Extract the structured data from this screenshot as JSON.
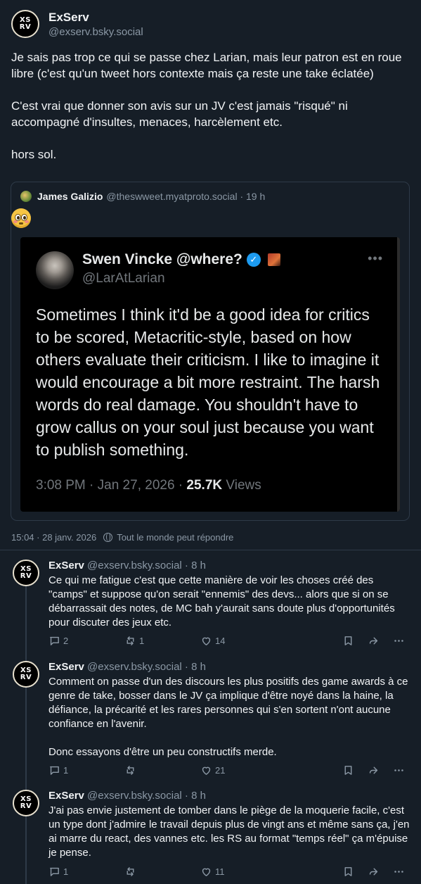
{
  "main_post": {
    "author": {
      "display_name": "ExServ",
      "handle": "@exserv.bsky.social",
      "avatar_text": [
        "XS",
        "RV"
      ]
    },
    "paragraphs": [
      "Je sais pas trop ce qui se passe chez Larian, mais leur patron est en roue libre (c'est qu'un tweet hors contexte mais ça reste une take éclatée)",
      "C'est vrai que donner son avis sur un JV c'est jamais \"risqué\" ni accompagné d'insultes, menaces, harcèlement etc.",
      "hors sol."
    ],
    "quote": {
      "display_name": "James Galizio",
      "handle_time": "@theswweet.myatproto.social · 19 h",
      "emoji": "flushed-face",
      "embedded_tweet": {
        "name": "Swen Vincke @where?",
        "handle": "@LarAtLarian",
        "body": "Sometimes I think it'd be a good idea for critics to be scored, Metacritic-style, based on how others evaluate their criticism. I like to imagine it would encourage a bit more restraint. The harsh words do real damage. You shouldn't have to grow callus on your soul just because you want  to publish something.",
        "time": "3:08 PM · Jan 27, 2026 · ",
        "views_count": "25.7K",
        "views_label": " Views"
      }
    },
    "timestamp": "15:04 · 28 janv. 2026",
    "reply_setting": "Tout le monde peut répondre"
  },
  "replies": [
    {
      "display_name": "ExServ",
      "handle_time": "@exserv.bsky.social · 8 h",
      "text": "Ce qui me fatigue c'est que cette manière de voir les choses créé des \"camps\" et suppose qu'on serait \"ennemis\" des devs... alors que si on se débarrassait des notes, de MC bah y'aurait sans doute plus d'opportunités pour discuter des jeux etc.",
      "replies": "2",
      "reposts": "1",
      "likes": "14"
    },
    {
      "display_name": "ExServ",
      "handle_time": "@exserv.bsky.social · 8 h",
      "text": "Comment on passe d'un des discours les plus positifs des game awards à ce genre de take, bosser dans le JV ça implique d'être noyé dans la haine, la défiance, la précarité et les rares personnes qui s'en sortent n'ont aucune confiance en l'avenir.\n\nDonc essayons d'être un peu constructifs merde.",
      "replies": "1",
      "reposts": "",
      "likes": "21"
    },
    {
      "display_name": "ExServ",
      "handle_time": "@exserv.bsky.social · 8 h",
      "text": "J'ai pas envie justement de tomber dans le piège de la moquerie facile, c'est un type dont j'admire le travail depuis plus de vingt ans et même sans ça, j'en ai marre du react, des vannes etc. les RS au format \"temps réel\" ça m'épuise je pense.",
      "replies": "1",
      "reposts": "",
      "likes": "11"
    }
  ],
  "colors": {
    "background": "#161e27",
    "muted": "#8b98a5",
    "border": "#2e3a48",
    "verified": "#1d9bf0"
  }
}
